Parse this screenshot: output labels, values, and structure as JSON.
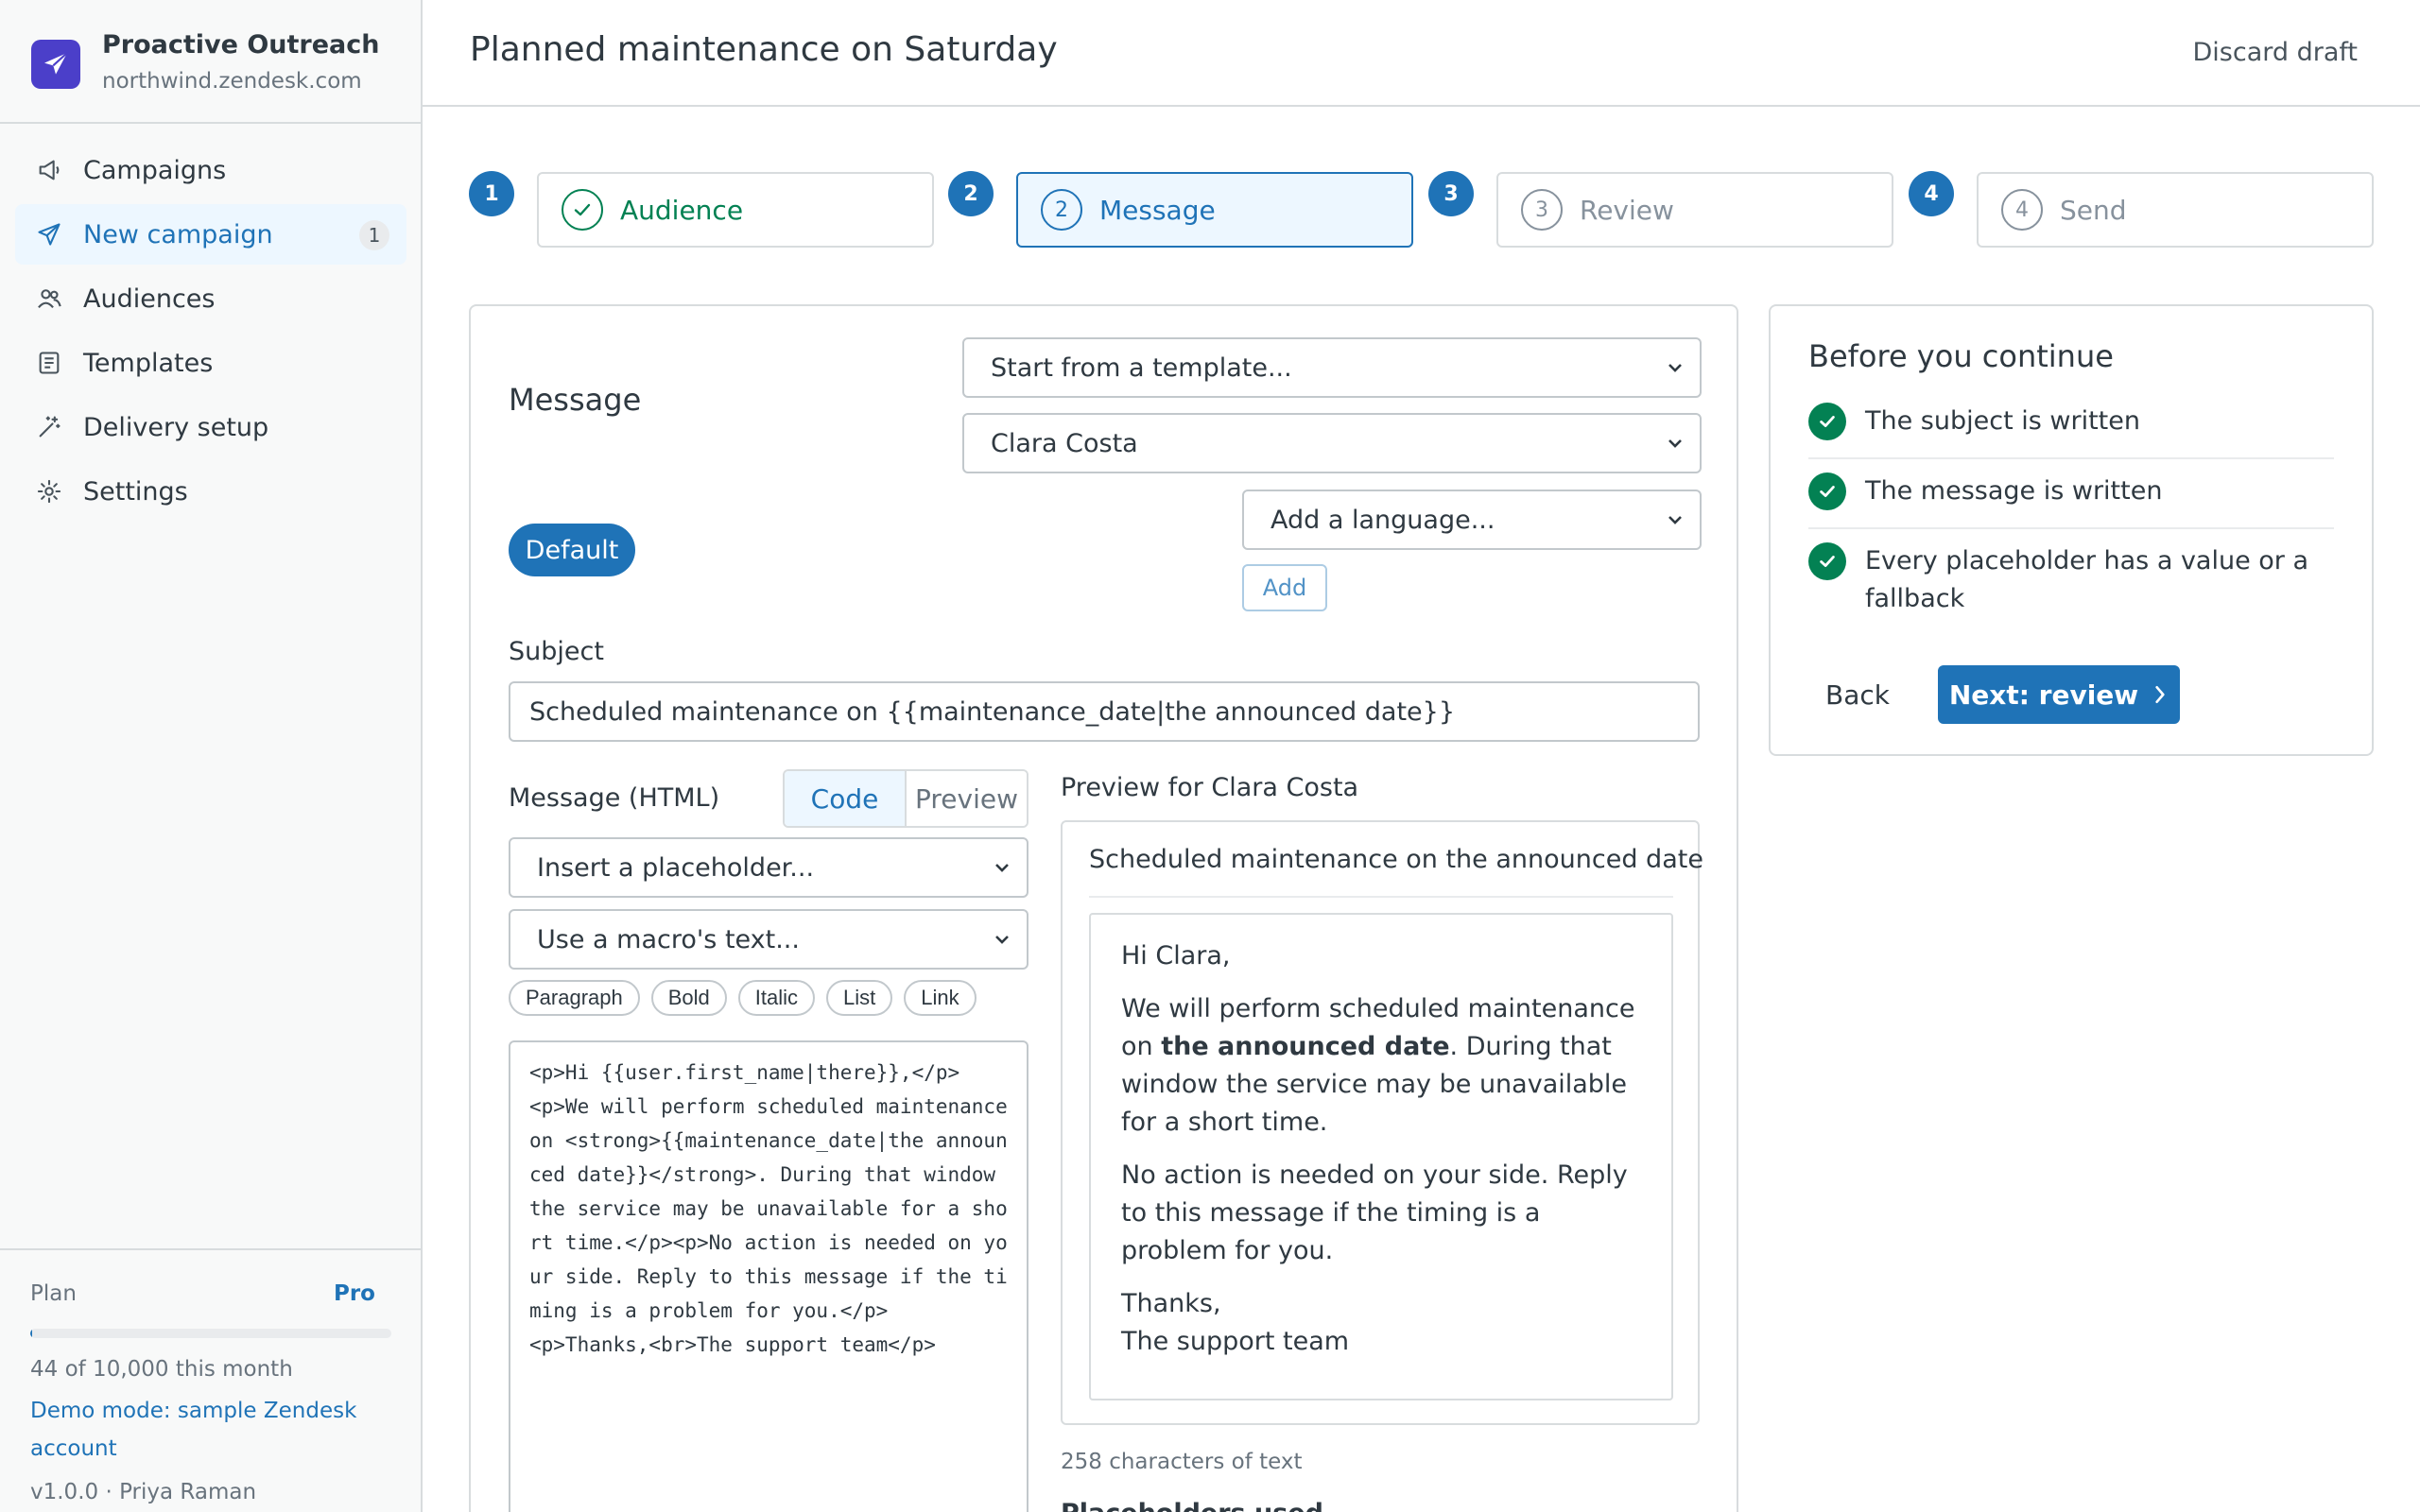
{
  "brand": {
    "name": "Proactive Outreach",
    "subdomain": "northwind.zendesk.com",
    "color": "#4b3fc9"
  },
  "sidebar": {
    "items": [
      {
        "label": "Campaigns",
        "icon": "megaphone-icon"
      },
      {
        "label": "New campaign",
        "icon": "paper-plane-icon",
        "badge": "1",
        "active": true
      },
      {
        "label": "Audiences",
        "icon": "users-icon"
      },
      {
        "label": "Templates",
        "icon": "document-icon"
      },
      {
        "label": "Delivery setup",
        "icon": "magic-wand-icon"
      },
      {
        "label": "Settings",
        "icon": "gear-icon"
      }
    ],
    "footer": {
      "plan_label": "Plan",
      "plan_value": "Pro",
      "usage_fraction": 0.0044,
      "usage_text": "44 of 10,000 this month",
      "demo_text": "Demo mode: sample Zendesk account",
      "version_text": "v1.0.0 · Priya Raman"
    }
  },
  "header": {
    "title": "Planned maintenance on Saturday",
    "discard_label": "Discard draft"
  },
  "stepper": {
    "steps": [
      {
        "number": "1",
        "label": "Audience",
        "state": "done"
      },
      {
        "number": "2",
        "label": "Message",
        "inner": "2",
        "state": "active"
      },
      {
        "number": "3",
        "label": "Review",
        "inner": "3",
        "state": "pending"
      },
      {
        "number": "4",
        "label": "Send",
        "inner": "4",
        "state": "pending"
      }
    ]
  },
  "editor": {
    "heading": "Message",
    "template_select": "Start from a template...",
    "recipient_select": "Clara Costa",
    "language_select": "Add a language...",
    "add_label": "Add",
    "default_label": "Default",
    "subject_label": "Subject",
    "subject_value": "Scheduled maintenance on {{maintenance_date|the announced date}}",
    "html_label": "Message (HTML)",
    "code_tab": "Code",
    "preview_tab": "Preview",
    "placeholder_select": "Insert a placeholder...",
    "macro_select": "Use a macro's text...",
    "format_buttons": [
      "Paragraph",
      "Bold",
      "Italic",
      "List",
      "Link"
    ],
    "code": "<p>Hi {{user.first_name|there}},</p>\n<p>We will perform scheduled maintenance on <strong>{{maintenance_date|the announced date}}</strong>. During that window the service may be unavailable for a short time.</p><p>No action is needed on your side. Reply to this message if the timing is a problem for you.</p>\n<p>Thanks,<br>The support team</p>"
  },
  "preview": {
    "label": "Preview for Clara Costa",
    "subject": "Scheduled maintenance on the announced date",
    "greeting": "Hi Clara,",
    "p1_before": "We will perform scheduled maintenance on ",
    "p1_bold": "the announced date",
    "p1_after": ". During that window the service may be unavailable for a short time.",
    "p2": "No action is needed on your side. Reply to this message if the timing is a problem for you.",
    "signoff": "Thanks,",
    "signature": "The support team",
    "char_count": "258 characters of text",
    "placeholders_title": "Placeholders used"
  },
  "checklist": {
    "title": "Before you continue",
    "items": [
      "The subject is written",
      "The message is written",
      "Every placeholder has a value or a fallback"
    ],
    "back_label": "Back",
    "next_label": "Next: review"
  },
  "colors": {
    "accent": "#1f73b7",
    "success": "#038153",
    "border": "#d8dcde"
  }
}
